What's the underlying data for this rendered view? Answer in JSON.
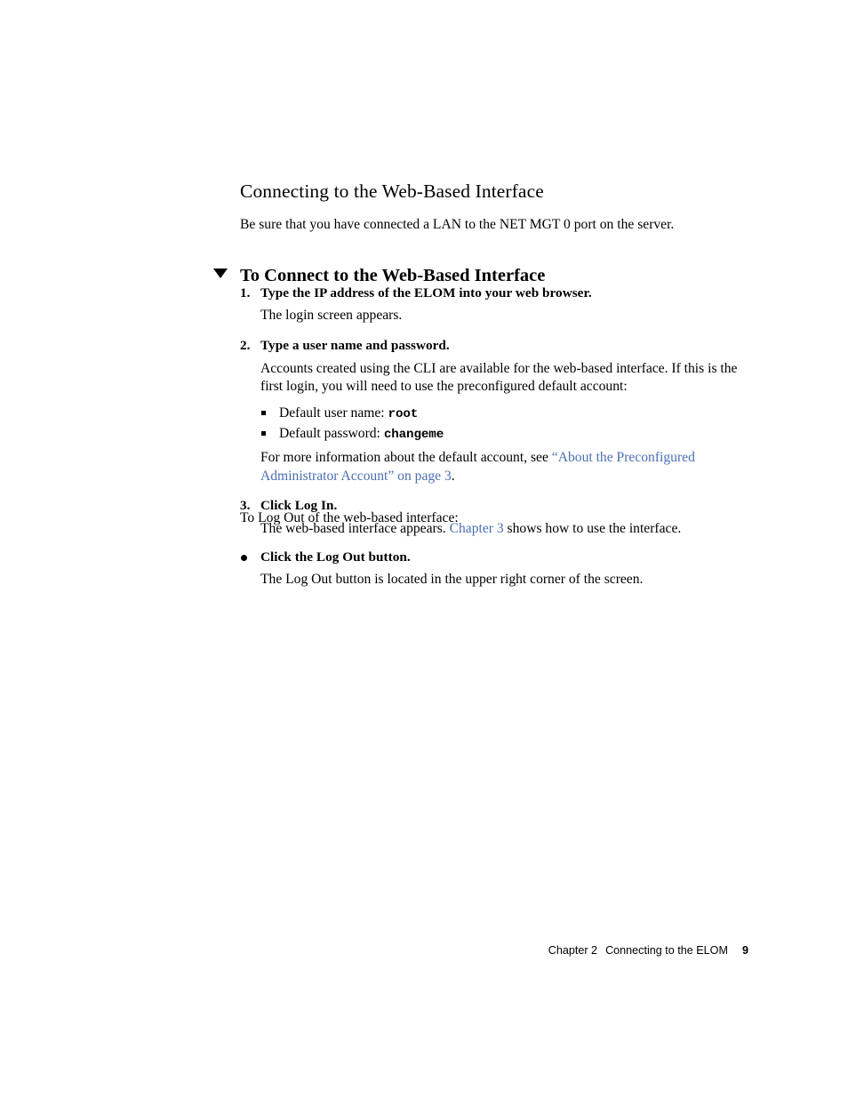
{
  "section": {
    "title": "Connecting to the Web-Based Interface",
    "intro": "Be sure that you have connected a LAN to the NET MGT 0 port on the server."
  },
  "procedure": {
    "heading": "To Connect to the Web-Based Interface",
    "marker_icon": "triangle-down-icon",
    "steps": [
      {
        "number": "1.",
        "title": "Type the IP address of the ELOM into your web browser.",
        "body": "The login screen appears."
      },
      {
        "number": "2.",
        "title": "Type a user name and password.",
        "body": "Accounts created using the CLI are available for the web-based interface. If this is the first login, you will need to use the preconfigured default account:",
        "sub_items": [
          {
            "label": "Default user name:",
            "value": "root"
          },
          {
            "label": "Default password:",
            "value": "changeme"
          }
        ],
        "footnote_prefix": "For more information about the default account, see ",
        "footnote_link": "“About the Preconfigured Administrator Account” on page 3",
        "footnote_suffix": "."
      },
      {
        "number": "3.",
        "title": "Click Log In.",
        "body_prefix": "The web-based interface appears. ",
        "body_link": "Chapter 3",
        "body_suffix": " shows how to use the interface."
      }
    ]
  },
  "logout": {
    "intro": "To Log Out of the web-based interface:",
    "bullet_icon": "round-bullet-icon",
    "title": "Click the Log Out button.",
    "body": "The Log Out button is located in the upper right corner of the screen."
  },
  "footer": {
    "chapter": "Chapter 2",
    "section": "Connecting to the ELOM",
    "page_number": "9"
  },
  "colors": {
    "link": "#4a6fb0",
    "text": "#000000",
    "background": "#ffffff"
  }
}
